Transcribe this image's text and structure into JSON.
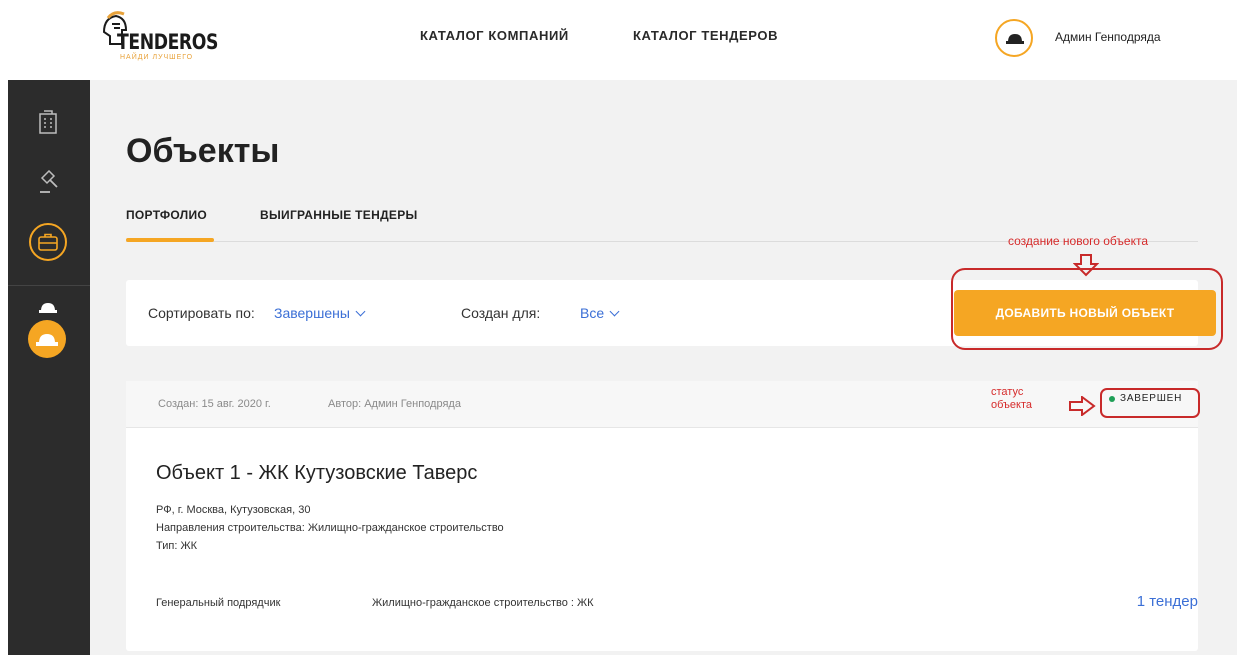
{
  "header": {
    "logo_text": "TENDEROS",
    "logo_tagline": "НАЙДИ ЛУЧШЕГО",
    "nav": [
      "КАТАЛОГ КОМПАНИЙ",
      "КАТАЛОГ ТЕНДЕРОВ"
    ],
    "user_name": "Админ Генподряда"
  },
  "sidebar": {
    "icons": [
      "buildings-icon",
      "gavel-icon",
      "briefcase-icon",
      "hard-hat-icon",
      "hard-hat-icon"
    ]
  },
  "page": {
    "title": "Объекты",
    "tabs": [
      "ПОРТФОЛИО",
      "ВЫИГРАННЫЕ ТЕНДЕРЫ"
    ],
    "active_tab": "ПОРТФОЛИО"
  },
  "annotations": {
    "create": "создание нового объекта",
    "status_line1": "статус",
    "status_line2": "объекта"
  },
  "toolbar": {
    "sort_label": "Сортировать по:",
    "sort_value": "Завершены",
    "created_label": "Создан для:",
    "created_value": "Все",
    "add_button": "ДОБАВИТЬ НОВЫЙ ОБЪЕКТ"
  },
  "card": {
    "created": "Создан: 15 авг. 2020 г.",
    "author": "Автор: Админ Генподряда",
    "status": "ЗАВЕРШЕН",
    "title": "Объект 1 - ЖК Кутузовские Таверс",
    "address": "РФ, г. Москва, Кутузовская, 30",
    "direction": "Направления строительства: Жилищно-гражданское строительство",
    "type": "Тип: ЖК",
    "contractor": "Генеральный подрядчик",
    "category": "Жилищно-гражданское строительство : ЖК",
    "tenders": "1 тендер"
  },
  "colors": {
    "accent": "#f5a623",
    "link": "#3b6fd6",
    "sidebar": "#2c2c2c",
    "status_dot": "#1f9f57",
    "annotation": "#d62b2b"
  }
}
